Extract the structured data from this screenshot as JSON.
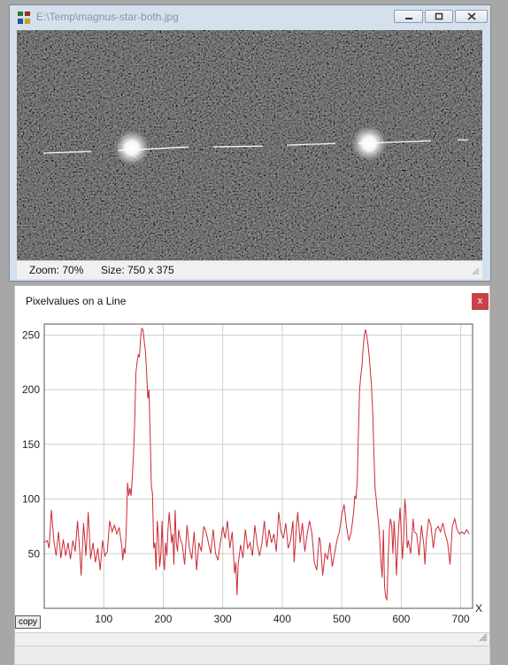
{
  "image_window": {
    "title": "E:\\Temp\\magnus-star-both.jpg",
    "zoom_text": "Zoom: 70%",
    "size_text": "Size: 750 x 375"
  },
  "plot_window": {
    "title": "Pixelvalues on a Line",
    "close_label": "x",
    "copy_label": "copy"
  },
  "chart_data": {
    "type": "line",
    "title": "",
    "xlabel": "X",
    "ylabel": "",
    "xlim": [
      0,
      720
    ],
    "ylim": [
      0,
      260
    ],
    "x_ticks": [
      100,
      200,
      300,
      400,
      500,
      600,
      700
    ],
    "y_ticks": [
      50,
      100,
      150,
      200,
      250
    ],
    "grid": true,
    "series": [
      {
        "color": "#cc2b36",
        "points": [
          [
            0,
            60
          ],
          [
            5,
            62
          ],
          [
            8,
            55
          ],
          [
            12,
            90
          ],
          [
            16,
            62
          ],
          [
            20,
            48
          ],
          [
            24,
            70
          ],
          [
            28,
            46
          ],
          [
            32,
            63
          ],
          [
            36,
            48
          ],
          [
            40,
            60
          ],
          [
            44,
            45
          ],
          [
            48,
            62
          ],
          [
            52,
            52
          ],
          [
            56,
            80
          ],
          [
            60,
            50
          ],
          [
            62,
            30
          ],
          [
            66,
            78
          ],
          [
            70,
            48
          ],
          [
            74,
            88
          ],
          [
            78,
            45
          ],
          [
            82,
            60
          ],
          [
            86,
            42
          ],
          [
            90,
            55
          ],
          [
            94,
            35
          ],
          [
            98,
            62
          ],
          [
            102,
            48
          ],
          [
            106,
            52
          ],
          [
            110,
            80
          ],
          [
            114,
            70
          ],
          [
            118,
            76
          ],
          [
            122,
            68
          ],
          [
            126,
            74
          ],
          [
            130,
            58
          ],
          [
            132,
            44
          ],
          [
            134,
            55
          ],
          [
            136,
            50
          ],
          [
            138,
            75
          ],
          [
            140,
            115
          ],
          [
            142,
            103
          ],
          [
            144,
            110
          ],
          [
            146,
            103
          ],
          [
            148,
            120
          ],
          [
            150,
            140
          ],
          [
            152,
            170
          ],
          [
            154,
            215
          ],
          [
            156,
            225
          ],
          [
            158,
            232
          ],
          [
            160,
            230
          ],
          [
            162,
            248
          ],
          [
            164,
            256
          ],
          [
            166,
            255
          ],
          [
            168,
            245
          ],
          [
            170,
            235
          ],
          [
            172,
            218
          ],
          [
            174,
            192
          ],
          [
            176,
            200
          ],
          [
            178,
            158
          ],
          [
            180,
            112
          ],
          [
            182,
            105
          ],
          [
            184,
            55
          ],
          [
            186,
            60
          ],
          [
            188,
            35
          ],
          [
            190,
            80
          ],
          [
            192,
            65
          ],
          [
            194,
            38
          ],
          [
            196,
            50
          ],
          [
            198,
            80
          ],
          [
            200,
            48
          ],
          [
            202,
            35
          ],
          [
            204,
            60
          ],
          [
            206,
            48
          ],
          [
            208,
            72
          ],
          [
            210,
            88
          ],
          [
            212,
            75
          ],
          [
            214,
            60
          ],
          [
            216,
            68
          ],
          [
            218,
            40
          ],
          [
            220,
            90
          ],
          [
            222,
            60
          ],
          [
            224,
            52
          ],
          [
            226,
            72
          ],
          [
            228,
            65
          ],
          [
            232,
            58
          ],
          [
            236,
            40
          ],
          [
            240,
            76
          ],
          [
            244,
            55
          ],
          [
            248,
            45
          ],
          [
            252,
            70
          ],
          [
            256,
            35
          ],
          [
            260,
            60
          ],
          [
            264,
            52
          ],
          [
            268,
            75
          ],
          [
            272,
            70
          ],
          [
            276,
            60
          ],
          [
            280,
            50
          ],
          [
            284,
            72
          ],
          [
            288,
            50
          ],
          [
            292,
            44
          ],
          [
            296,
            60
          ],
          [
            300,
            75
          ],
          [
            304,
            64
          ],
          [
            308,
            80
          ],
          [
            312,
            55
          ],
          [
            316,
            70
          ],
          [
            318,
            50
          ],
          [
            320,
            32
          ],
          [
            322,
            42
          ],
          [
            324,
            12
          ],
          [
            326,
            40
          ],
          [
            330,
            58
          ],
          [
            334,
            46
          ],
          [
            338,
            72
          ],
          [
            342,
            55
          ],
          [
            346,
            60
          ],
          [
            350,
            48
          ],
          [
            354,
            76
          ],
          [
            358,
            58
          ],
          [
            362,
            48
          ],
          [
            366,
            60
          ],
          [
            370,
            80
          ],
          [
            374,
            56
          ],
          [
            378,
            72
          ],
          [
            382,
            60
          ],
          [
            386,
            68
          ],
          [
            390,
            52
          ],
          [
            394,
            88
          ],
          [
            398,
            70
          ],
          [
            402,
            64
          ],
          [
            406,
            78
          ],
          [
            410,
            55
          ],
          [
            414,
            62
          ],
          [
            418,
            80
          ],
          [
            420,
            42
          ],
          [
            424,
            75
          ],
          [
            426,
            88
          ],
          [
            430,
            60
          ],
          [
            434,
            78
          ],
          [
            438,
            52
          ],
          [
            442,
            68
          ],
          [
            446,
            80
          ],
          [
            450,
            68
          ],
          [
            454,
            42
          ],
          [
            458,
            35
          ],
          [
            462,
            65
          ],
          [
            464,
            62
          ],
          [
            468,
            30
          ],
          [
            472,
            50
          ],
          [
            476,
            45
          ],
          [
            480,
            60
          ],
          [
            484,
            38
          ],
          [
            488,
            50
          ],
          [
            492,
            62
          ],
          [
            496,
            70
          ],
          [
            500,
            85
          ],
          [
            504,
            95
          ],
          [
            508,
            75
          ],
          [
            512,
            62
          ],
          [
            516,
            70
          ],
          [
            520,
            88
          ],
          [
            522,
            103
          ],
          [
            524,
            100
          ],
          [
            526,
            115
          ],
          [
            528,
            158
          ],
          [
            530,
            200
          ],
          [
            532,
            212
          ],
          [
            534,
            222
          ],
          [
            536,
            238
          ],
          [
            538,
            250
          ],
          [
            540,
            255
          ],
          [
            542,
            250
          ],
          [
            544,
            242
          ],
          [
            546,
            232
          ],
          [
            548,
            218
          ],
          [
            550,
            204
          ],
          [
            552,
            180
          ],
          [
            554,
            145
          ],
          [
            556,
            110
          ],
          [
            558,
            100
          ],
          [
            560,
            88
          ],
          [
            562,
            78
          ],
          [
            564,
            62
          ],
          [
            566,
            42
          ],
          [
            568,
            28
          ],
          [
            570,
            72
          ],
          [
            572,
            20
          ],
          [
            574,
            10
          ],
          [
            576,
            8
          ],
          [
            578,
            42
          ],
          [
            580,
            72
          ],
          [
            582,
            82
          ],
          [
            584,
            76
          ],
          [
            586,
            50
          ],
          [
            588,
            80
          ],
          [
            590,
            60
          ],
          [
            592,
            30
          ],
          [
            594,
            55
          ],
          [
            596,
            75
          ],
          [
            598,
            92
          ],
          [
            600,
            70
          ],
          [
            602,
            45
          ],
          [
            604,
            62
          ],
          [
            606,
            100
          ],
          [
            608,
            88
          ],
          [
            610,
            55
          ],
          [
            612,
            62
          ],
          [
            616,
            50
          ],
          [
            620,
            82
          ],
          [
            622,
            70
          ],
          [
            626,
            68
          ],
          [
            630,
            48
          ],
          [
            634,
            76
          ],
          [
            638,
            58
          ],
          [
            640,
            40
          ],
          [
            642,
            62
          ],
          [
            646,
            82
          ],
          [
            650,
            76
          ],
          [
            654,
            55
          ],
          [
            658,
            72
          ],
          [
            662,
            75
          ],
          [
            666,
            70
          ],
          [
            670,
            78
          ],
          [
            674,
            68
          ],
          [
            678,
            60
          ],
          [
            682,
            40
          ],
          [
            686,
            75
          ],
          [
            690,
            82
          ],
          [
            694,
            72
          ],
          [
            698,
            68
          ],
          [
            702,
            70
          ],
          [
            706,
            68
          ],
          [
            710,
            72
          ],
          [
            714,
            68
          ]
        ]
      }
    ]
  }
}
